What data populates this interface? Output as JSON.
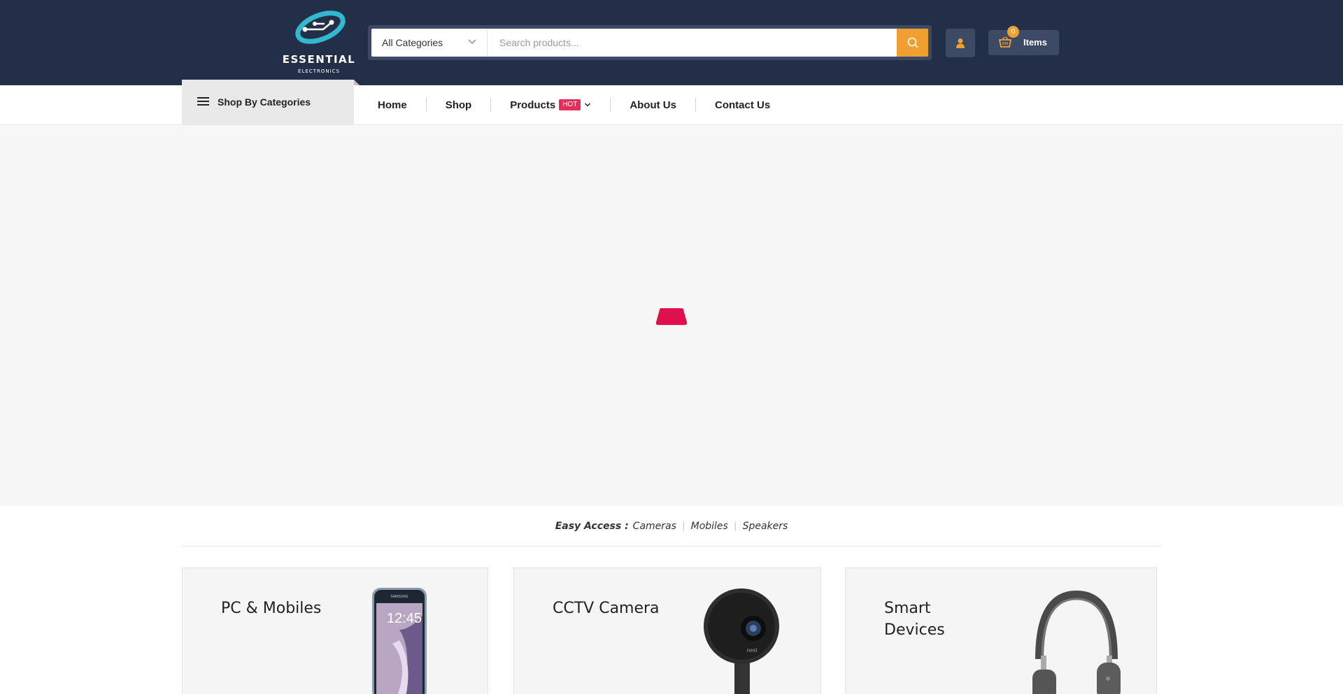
{
  "header": {
    "logo": {
      "brand": "ESSENTIAL",
      "sub": "ELECTRONICS"
    },
    "search": {
      "category_selected": "All Categories",
      "placeholder": "Search products...",
      "value": ""
    },
    "cart": {
      "count": "0",
      "label": "Items"
    },
    "colors": {
      "header_bg": "#232f48",
      "accent": "#f0a030",
      "button_bg": "#3d4a66"
    }
  },
  "nav": {
    "categories_label": "Shop By Categories",
    "links": [
      {
        "label": "Home"
      },
      {
        "label": "Shop"
      },
      {
        "label": "Products",
        "badge": "HOT"
      },
      {
        "label": "About Us"
      },
      {
        "label": "Contact Us"
      }
    ],
    "badge_color": "#e62e5c"
  },
  "easy_access": {
    "title": "Easy Access :",
    "links": [
      "Cameras",
      "Mobiles",
      "Speakers"
    ]
  },
  "cards": [
    {
      "title_line1": "PC & Mobiles",
      "title_line2": "",
      "icon": "smartphone-image"
    },
    {
      "title_line1": "CCTV Camera",
      "title_line2": "",
      "icon": "security-camera-image"
    },
    {
      "title_line1": "Smart",
      "title_line2": "Devices",
      "icon": "headphones-image"
    }
  ],
  "phone_screen": {
    "time": "12:45",
    "brand": "SAMSUNG"
  },
  "camera_brand": "nest",
  "loader_color": "#e0104e"
}
